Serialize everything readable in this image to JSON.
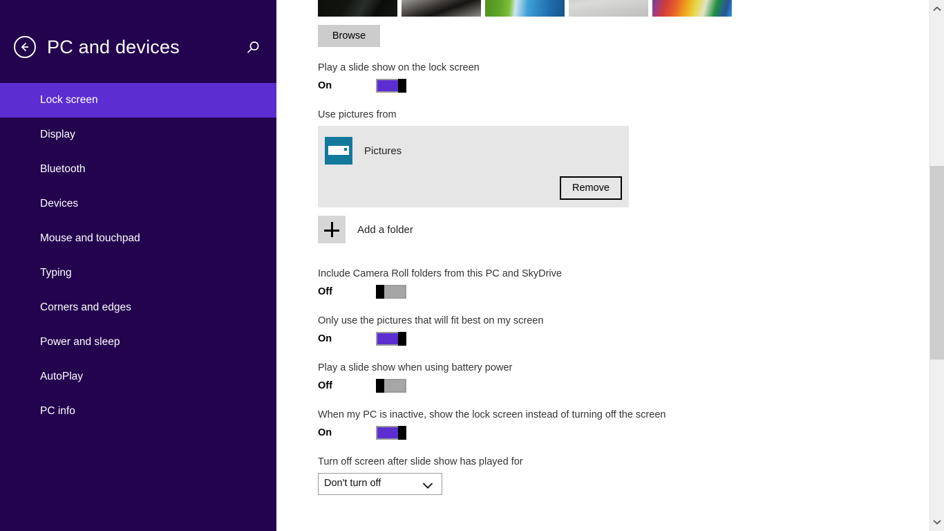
{
  "header": {
    "title": "PC and devices",
    "back_icon": "back-arrow-icon",
    "search_icon": "search-icon"
  },
  "sidebar": {
    "background_color": "#23024e",
    "selected_color": "#5c2ed1",
    "items": [
      {
        "label": "Lock screen",
        "selected": true
      },
      {
        "label": "Display",
        "selected": false
      },
      {
        "label": "Bluetooth",
        "selected": false
      },
      {
        "label": "Devices",
        "selected": false
      },
      {
        "label": "Mouse and touchpad",
        "selected": false
      },
      {
        "label": "Typing",
        "selected": false
      },
      {
        "label": "Corners and edges",
        "selected": false
      },
      {
        "label": "Power and sleep",
        "selected": false
      },
      {
        "label": "AutoPlay",
        "selected": false
      },
      {
        "label": "PC info",
        "selected": false
      }
    ]
  },
  "main": {
    "thumbnails": [
      {
        "name": "dark-scene-thumbnail"
      },
      {
        "name": "gray-rock-thumbnail"
      },
      {
        "name": "green-blue-pool-thumbnail"
      },
      {
        "name": "water-droplets-thumbnail"
      },
      {
        "name": "colored-pencils-thumbnail"
      }
    ],
    "browse_label": "Browse",
    "slideshow": {
      "label": "Play a slide show on the lock screen",
      "state": "On",
      "on": true
    },
    "use_pictures_from": {
      "label": "Use pictures from",
      "folders": [
        {
          "name": "Pictures",
          "remove_label": "Remove"
        }
      ],
      "add_folder_label": "Add a folder"
    },
    "camera_roll": {
      "label": "Include Camera Roll folders from this PC and SkyDrive",
      "state": "Off",
      "on": false
    },
    "fit_best": {
      "label": "Only use the pictures that will fit best on my screen",
      "state": "On",
      "on": true
    },
    "battery_power": {
      "label": "Play a slide show when using battery power",
      "state": "Off",
      "on": false
    },
    "inactive_lock": {
      "label": "When my PC is inactive, show the lock screen instead of turning off the screen",
      "state": "On",
      "on": true
    },
    "turn_off_screen": {
      "label": "Turn off screen after slide show has played for",
      "selected_option": "Don't turn off"
    }
  },
  "scrollbar": {
    "up_arrow_icon": "chevron-up-icon",
    "down_arrow_icon": "chevron-down-icon"
  },
  "colors": {
    "accent_purple": "#5c2ed1",
    "sidebar_dark": "#23024e",
    "folder_icon_teal": "#12799c"
  }
}
